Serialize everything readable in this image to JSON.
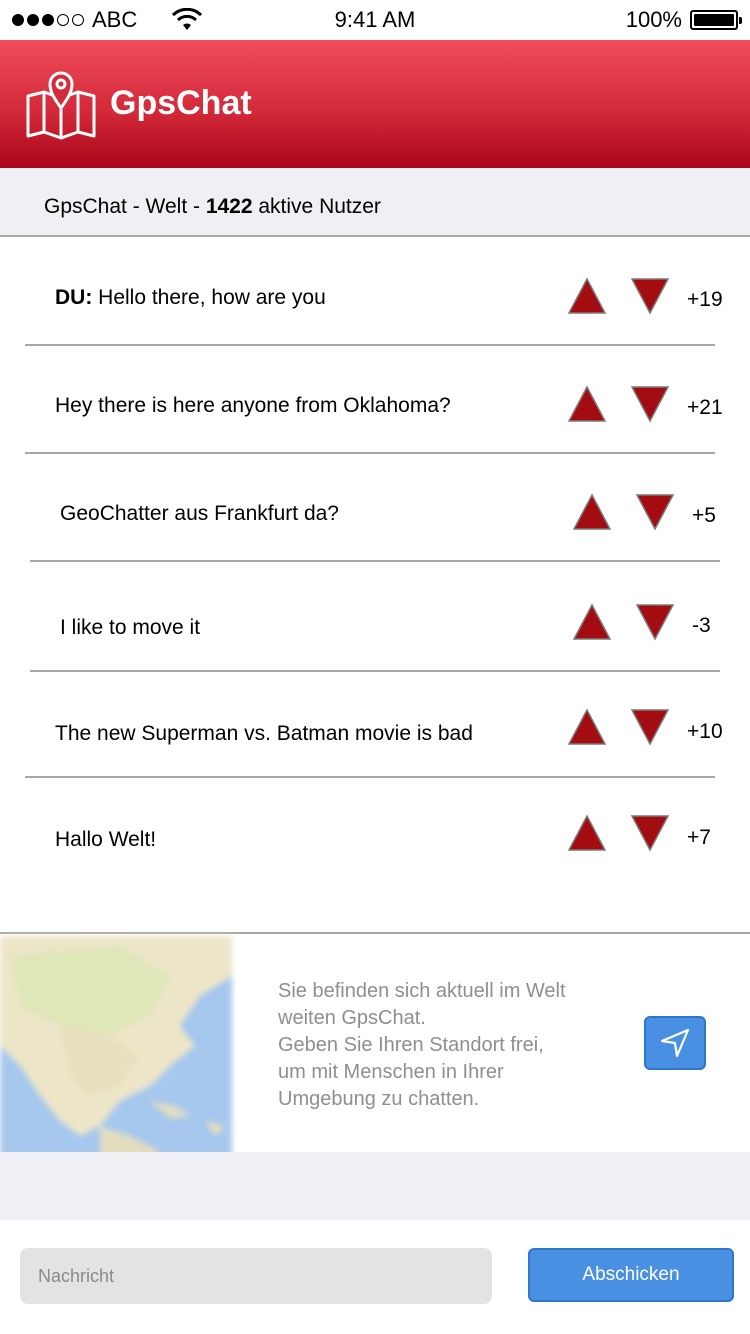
{
  "status_bar": {
    "carrier": "ABC",
    "time": "9:41 AM",
    "battery": "100%"
  },
  "app": {
    "title": "GpsChat",
    "logo_icon": "map-pin-icon"
  },
  "subheader": {
    "prefix": "GpsChat - Welt - ",
    "active_count": "1422",
    "suffix": " aktive Nutzer"
  },
  "messages": [
    {
      "author": "DU:",
      "text": " Hello there, how are you",
      "score": "+19"
    },
    {
      "author": "",
      "text": "Hey there is here anyone from Oklahoma?",
      "score": "+21"
    },
    {
      "author": "",
      "text": "GeoChatter aus Frankfurt da?",
      "score": "+5"
    },
    {
      "author": "",
      "text": "I like to move it",
      "score": "-3"
    },
    {
      "author": "",
      "text": "The new Superman vs. Batman movie is bad",
      "score": "+10"
    },
    {
      "author": "",
      "text": "Hallo Welt!",
      "score": "+7"
    }
  ],
  "location": {
    "line1": "Sie befinden sich aktuell im Welt",
    "line2": "weiten GpsChat.",
    "line3": "Geben Sie Ihren Standort frei,",
    "line4": "um mit Menschen in Ihrer",
    "line5": "Umgebung zu chatten.",
    "button_icon": "location-arrow-icon"
  },
  "composer": {
    "placeholder": "Nachricht",
    "send_label": "Abschicken"
  },
  "colors": {
    "brand_red": "#d42a3a",
    "vote_red": "#a30d12",
    "accent_blue": "#4a90e2"
  }
}
